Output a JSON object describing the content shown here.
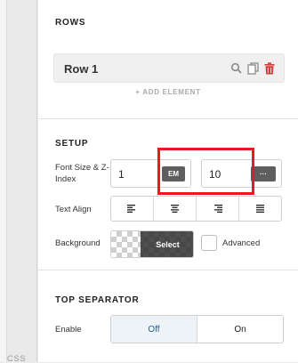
{
  "gutter": {
    "code_tab": "CSS"
  },
  "rows_section": {
    "title": "ROWS",
    "row": {
      "label": "Row 1",
      "icons": [
        "search-icon",
        "copy-icon",
        "trash-icon"
      ]
    },
    "add_element": "+ ADD ELEMENT"
  },
  "setup": {
    "title": "SETUP",
    "font_size_label": "Font Size & Z-Index",
    "font_size": {
      "value": "1",
      "unit": "EM"
    },
    "z_index": {
      "value": "10",
      "menu": "···"
    },
    "text_align_label": "Text Align",
    "text_align_options": [
      "align-left-icon",
      "align-center-icon",
      "align-right-icon",
      "align-justify-icon"
    ],
    "background_label": "Background",
    "background_select": "Select",
    "advanced_label": "Advanced"
  },
  "top_separator": {
    "title": "TOP SEPARATOR",
    "enable_label": "Enable",
    "options": [
      "Off",
      "On"
    ],
    "selected": "Off"
  },
  "colors": {
    "accent": "#1f5f9e",
    "highlight": "#e61c1c",
    "delete": "#d63b3b",
    "unit_chip": "#5e5e5e"
  }
}
